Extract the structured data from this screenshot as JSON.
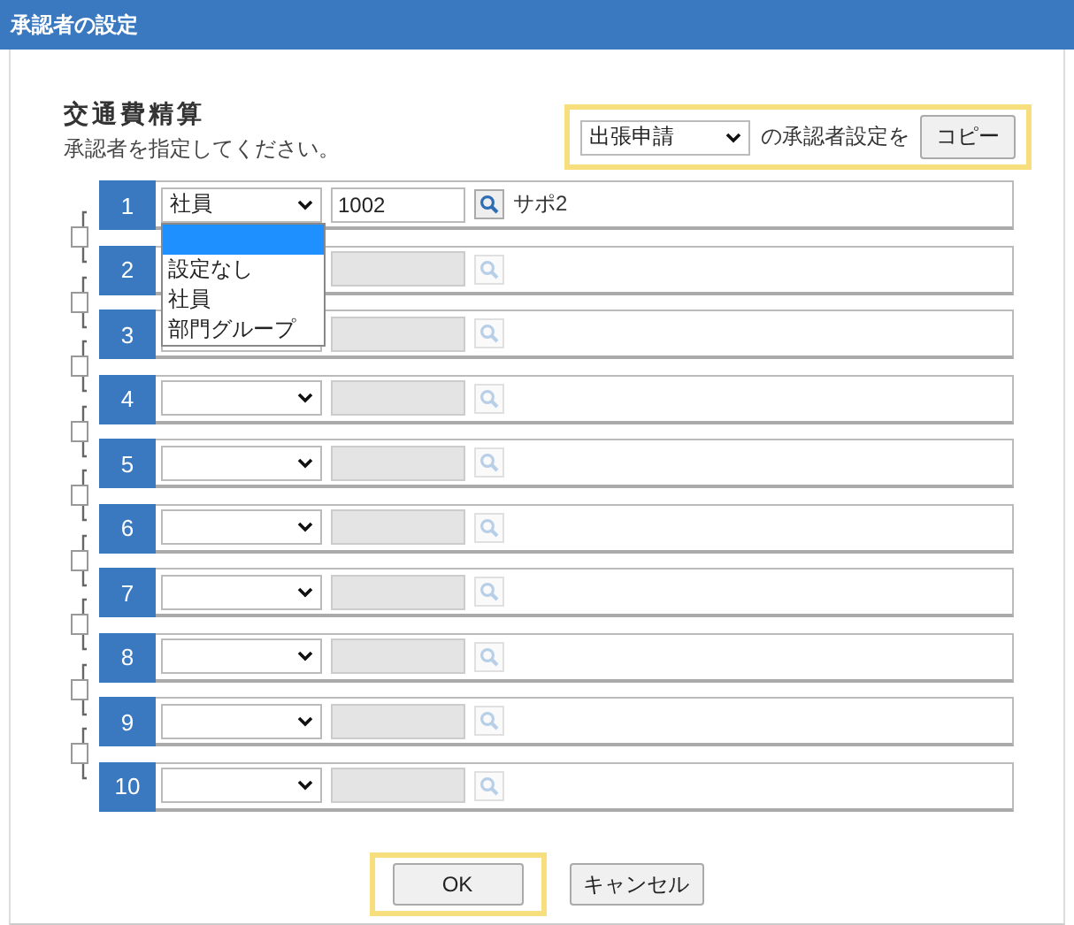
{
  "window": {
    "title": "承認者の設定"
  },
  "heading": "交通費精算",
  "instruction": "承認者を指定してください。",
  "copy": {
    "highlighted": true,
    "source": "出張申請",
    "text": "の承認者設定を",
    "button": "コピー"
  },
  "approvers": [
    {
      "number": "1",
      "type": "社員",
      "code": "1002",
      "name": "サポ2",
      "enabled": true
    },
    {
      "number": "2",
      "enabled": false
    },
    {
      "number": "3",
      "enabled": false
    },
    {
      "number": "4",
      "enabled": false
    },
    {
      "number": "5",
      "enabled": false
    },
    {
      "number": "6",
      "enabled": false
    },
    {
      "number": "7",
      "enabled": false
    },
    {
      "number": "8",
      "enabled": false
    },
    {
      "number": "9",
      "enabled": false
    },
    {
      "number": "10",
      "enabled": false
    }
  ],
  "dropdown": {
    "open": true,
    "options": [
      {
        "selected": true
      },
      {
        "label": "設定なし",
        "selected": false
      },
      {
        "label": "社員",
        "selected": false
      },
      {
        "label": "部門グループ",
        "selected": false
      }
    ]
  },
  "buttons": [
    {
      "label": "OK",
      "highlighted": true
    },
    {
      "label": "キャンセル",
      "highlighted": false
    }
  ]
}
